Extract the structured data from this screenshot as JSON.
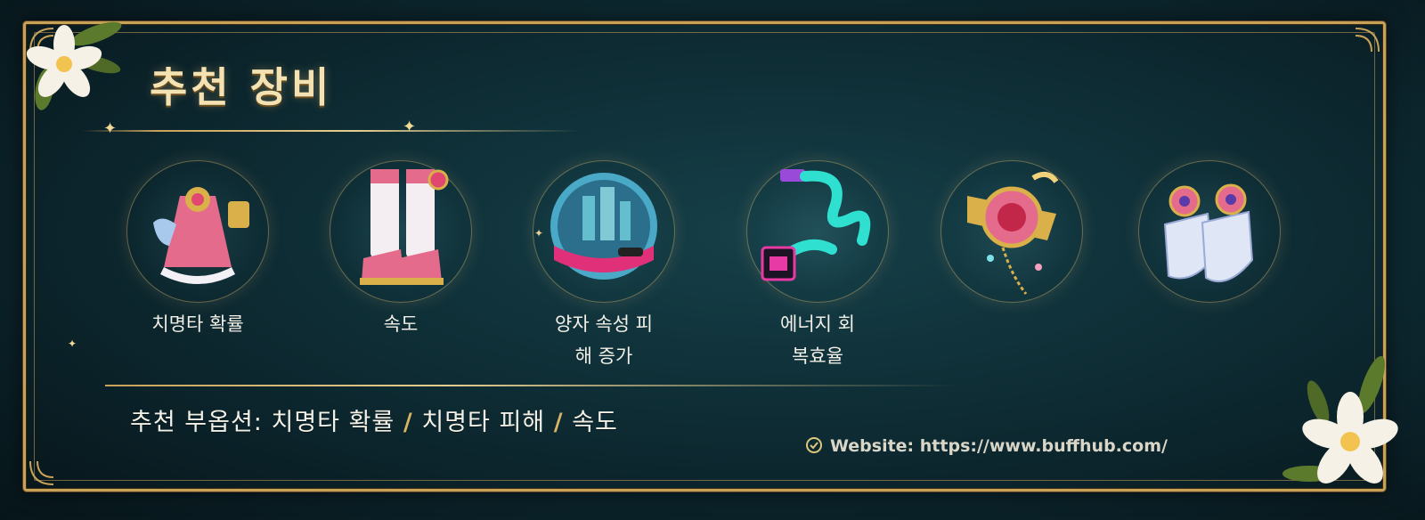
{
  "title": "추천 장비",
  "items": [
    {
      "label": "치명타 확률",
      "icon": "pink-dress-icon"
    },
    {
      "label": "속도",
      "icon": "pink-boots-icon"
    },
    {
      "label": "양자 속성 피",
      "label2": "해 증가",
      "icon": "cyber-orb-icon"
    },
    {
      "label": "에너지 회",
      "label2": "복효율",
      "icon": "neon-cable-icon"
    },
    {
      "label": "",
      "icon": "heart-brooch-icon"
    },
    {
      "label": "",
      "icon": "white-gloves-icon"
    }
  ],
  "substats": {
    "prefix": "추천 부옵션:",
    "stat1": "치명타 확률",
    "sep1": "/",
    "stat2": "치명타 피해",
    "sep2": "/",
    "stat3": "속도"
  },
  "website": "Website: https://www.buffhub.com/",
  "colors": {
    "gold": "#c9a25a",
    "title": "#f4e2b2",
    "bg": "#0f2f37"
  }
}
